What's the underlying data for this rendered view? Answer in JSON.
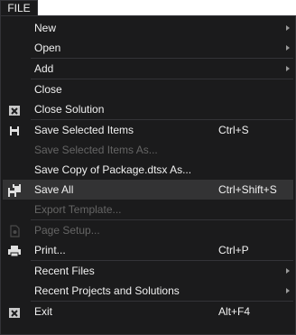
{
  "tab": {
    "label": "FILE"
  },
  "menu": {
    "new": "New",
    "open": "Open",
    "add": "Add",
    "close": "Close",
    "close_solution": "Close Solution",
    "save_selected": "Save Selected Items",
    "save_selected_shortcut": "Ctrl+S",
    "save_selected_as": "Save Selected Items As...",
    "save_copy": "Save Copy of Package.dtsx As...",
    "save_all": "Save All",
    "save_all_shortcut": "Ctrl+Shift+S",
    "export_template": "Export Template...",
    "page_setup": "Page Setup...",
    "print": "Print...",
    "print_shortcut": "Ctrl+P",
    "recent_files": "Recent Files",
    "recent_projects": "Recent Projects and Solutions",
    "exit": "Exit",
    "exit_shortcut": "Alt+F4"
  },
  "colors": {
    "background": "#1b1b1c",
    "text": "#f1f1f1",
    "disabled_text": "#656565",
    "hover": "#333334",
    "separator": "#333337"
  }
}
